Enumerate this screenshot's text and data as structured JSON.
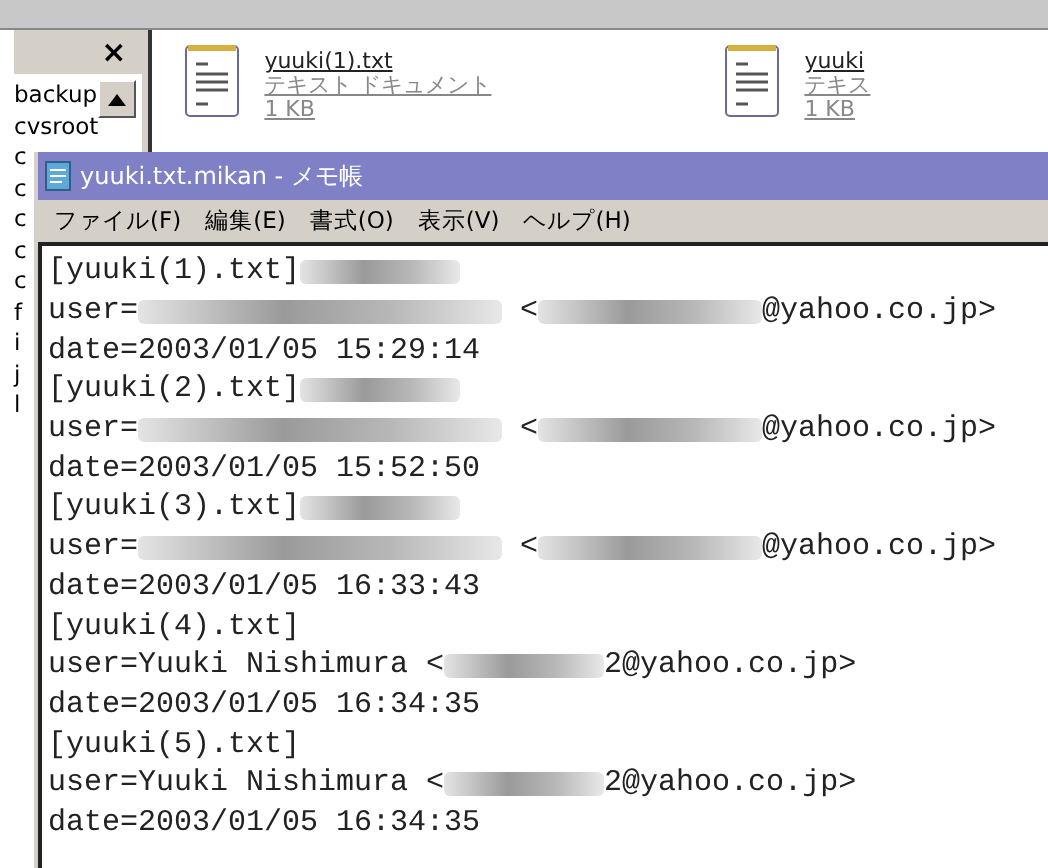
{
  "explorer": {
    "folder_pane": {
      "close": "×",
      "items": [
        "backup",
        "cvsroot"
      ],
      "clipped_items": [
        "c",
        "c",
        "c",
        "c",
        "c",
        "f",
        "i",
        "j",
        "l"
      ]
    },
    "files": [
      {
        "name": "yuuki(1).txt",
        "type": "テキスト ドキュメント",
        "size": "1 KB"
      },
      {
        "name": "yuuki",
        "type": "テキス",
        "size": "1 KB"
      }
    ]
  },
  "notepad": {
    "title": "yuuki.txt.mikan - メモ帳",
    "menu": [
      "ファイル(F)",
      "編集(E)",
      "書式(O)",
      "表示(V)",
      "ヘルプ(H)"
    ],
    "lines": [
      [
        {
          "kind": "text",
          "text": "[yuuki(1).txt]"
        },
        {
          "kind": "redacted_narrow"
        }
      ],
      [
        {
          "kind": "text",
          "text": "user="
        },
        {
          "kind": "redacted_wide"
        },
        {
          "kind": "text",
          "text": " <"
        },
        {
          "kind": "redacted_medium"
        },
        {
          "kind": "text",
          "text": "@yahoo.co.jp>"
        }
      ],
      [
        {
          "kind": "text",
          "text": "date=2003/01/05 15:29:14"
        }
      ],
      [
        {
          "kind": "text",
          "text": "[yuuki(2).txt]"
        },
        {
          "kind": "redacted_narrow"
        }
      ],
      [
        {
          "kind": "text",
          "text": "user="
        },
        {
          "kind": "redacted_wide"
        },
        {
          "kind": "text",
          "text": " <"
        },
        {
          "kind": "redacted_medium"
        },
        {
          "kind": "text",
          "text": "@yahoo.co.jp>"
        }
      ],
      [
        {
          "kind": "text",
          "text": "date=2003/01/05 15:52:50"
        }
      ],
      [
        {
          "kind": "text",
          "text": "[yuuki(3).txt]"
        },
        {
          "kind": "redacted_narrow"
        }
      ],
      [
        {
          "kind": "text",
          "text": "user="
        },
        {
          "kind": "redacted_wide"
        },
        {
          "kind": "text",
          "text": " <"
        },
        {
          "kind": "redacted_medium"
        },
        {
          "kind": "text",
          "text": "@yahoo.co.jp>"
        }
      ],
      [
        {
          "kind": "text",
          "text": "date=2003/01/05 16:33:43"
        }
      ],
      [
        {
          "kind": "text",
          "text": "[yuuki(4).txt]"
        }
      ],
      [
        {
          "kind": "text",
          "text": "user=Yuuki Nishimura <"
        },
        {
          "kind": "redacted_narrow"
        },
        {
          "kind": "text",
          "text": "2@yahoo.co.jp>"
        }
      ],
      [
        {
          "kind": "text",
          "text": "date=2003/01/05 16:34:35"
        }
      ],
      [
        {
          "kind": "text",
          "text": "[yuuki(5).txt]"
        }
      ],
      [
        {
          "kind": "text",
          "text": "user=Yuuki Nishimura <"
        },
        {
          "kind": "redacted_narrow"
        },
        {
          "kind": "text",
          "text": "2@yahoo.co.jp>"
        }
      ],
      [
        {
          "kind": "text",
          "text": "date=2003/01/05 16:34:35"
        }
      ]
    ]
  }
}
